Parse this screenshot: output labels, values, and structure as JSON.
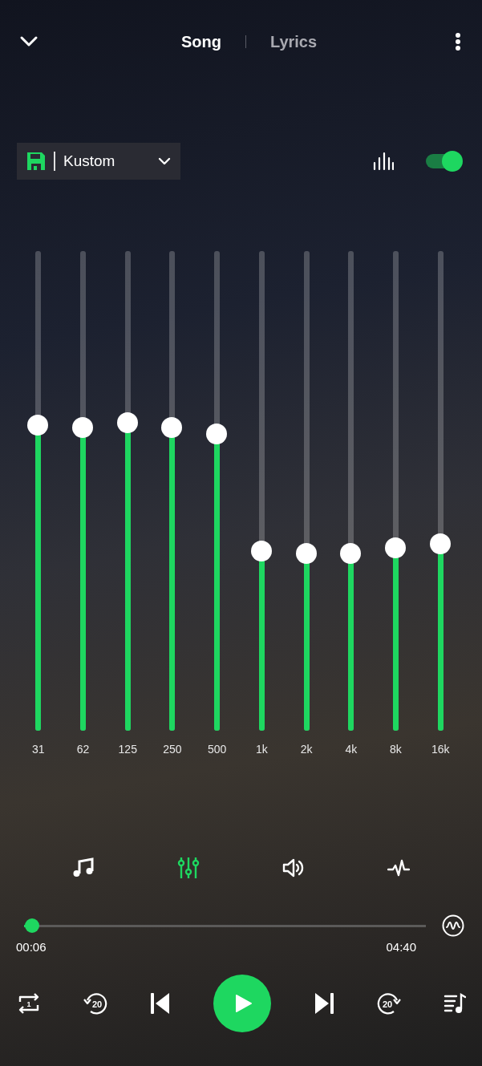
{
  "header": {
    "tabs": [
      {
        "label": "Song",
        "selected": true
      },
      {
        "label": "Lyrics",
        "selected": false
      }
    ]
  },
  "preset": {
    "value": "Kustom"
  },
  "eq_enabled": {
    "on": true
  },
  "bands": [
    {
      "label": "31",
      "level": 0.637
    },
    {
      "label": "62",
      "level": 0.632
    },
    {
      "label": "125",
      "level": 0.642
    },
    {
      "label": "250",
      "level": 0.632
    },
    {
      "label": "500",
      "level": 0.619
    },
    {
      "label": "1k",
      "level": 0.375
    },
    {
      "label": "2k",
      "level": 0.37
    },
    {
      "label": "4k",
      "level": 0.37
    },
    {
      "label": "8k",
      "level": 0.381
    },
    {
      "label": "16k",
      "level": 0.39
    }
  ],
  "effect_tabs": [
    {
      "kind": "music",
      "selected": false
    },
    {
      "kind": "equalizer",
      "selected": true
    },
    {
      "kind": "volume",
      "selected": false
    },
    {
      "kind": "pulse",
      "selected": false
    }
  ],
  "progress": {
    "level": 0.02,
    "elapsed": "00:06",
    "duration": "04:40"
  },
  "controls": [
    {
      "kind": "repeat",
      "badge": "1"
    },
    {
      "kind": "rewind",
      "badge": "20"
    },
    {
      "kind": "previous"
    },
    {
      "kind": "play"
    },
    {
      "kind": "next"
    },
    {
      "kind": "forward",
      "badge": "20"
    },
    {
      "kind": "queue"
    }
  ]
}
